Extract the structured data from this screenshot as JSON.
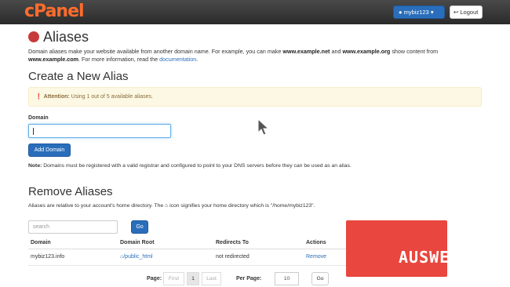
{
  "header": {
    "logo": "cPanel",
    "user_button": "mybiz123",
    "logout_button": "Logout"
  },
  "page": {
    "title": "Aliases",
    "desc_part1": "Domain aliases make your website available from another domain name. For example, you can make ",
    "desc_ex1": "www.example.net",
    "desc_part2": " and ",
    "desc_ex2": "www.example.org",
    "desc_part3": " show content from ",
    "desc_ex3": "www.example.com",
    "desc_part4": ". For more information, read the ",
    "desc_link": "documentation",
    "desc_end": "."
  },
  "create": {
    "heading": "Create a New Alias",
    "alert_strong": "Attention:",
    "alert_text": " Using 1 out of 5 available aliases.",
    "domain_label": "Domain",
    "domain_value": "",
    "add_button": "Add Domain",
    "note_strong": "Note:",
    "note_text": " Domains must be registered with a valid registrar and configured to point to your DNS servers before they can be used as an alias."
  },
  "remove": {
    "heading": "Remove Aliases",
    "hint_part1": "Aliases are relative to your account's home directory. The ",
    "hint_part2": " icon signifies your home directory which is \"/home/mybiz123\".",
    "search_placeholder": "search",
    "go_button": "Go",
    "columns": [
      "Domain",
      "Domain Root",
      "Redirects To",
      "Actions"
    ],
    "rows": [
      {
        "domain": "mybiz123.info",
        "root": "/public_html",
        "redirect": "not redirected",
        "action": "Remove"
      }
    ]
  },
  "pagination": {
    "page_label": "Page:",
    "first": "First",
    "current": "1",
    "last": "Last",
    "per_page_label": "Per Page:",
    "per_page_value": "10",
    "go": "Go"
  },
  "overlay": {
    "watermark": "AUSWEB"
  },
  "colors": {
    "accent": "#2a6ebb",
    "logo": "#ff6c2c",
    "watermark": "#e8463e",
    "alert_bg": "#fcf8e3"
  },
  "icons": [
    "user-icon",
    "caret-down-icon",
    "logout-icon",
    "aliases-icon",
    "warning-icon",
    "home-icon",
    "mouse-cursor-icon"
  ]
}
